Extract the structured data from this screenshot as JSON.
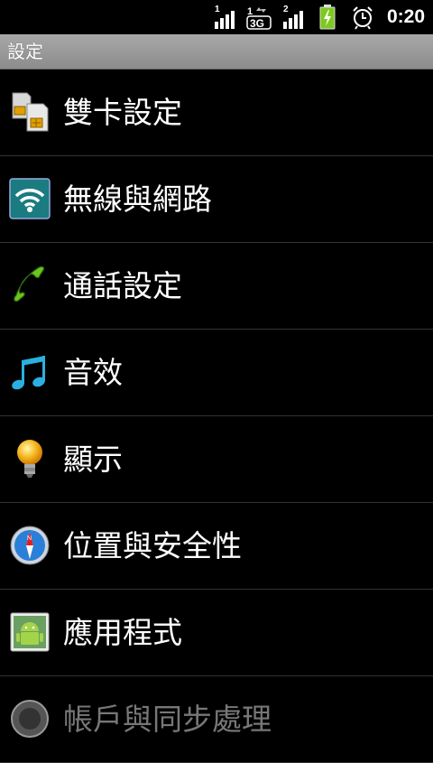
{
  "status_bar": {
    "sim1_label": "1",
    "sim2_label": "2",
    "network_type": "3G",
    "time": "0:20",
    "icons": [
      "signal-sim1-icon",
      "3g-data-icon",
      "signal-sim2-icon",
      "battery-charging-icon",
      "alarm-icon"
    ]
  },
  "title_bar": {
    "title": "設定"
  },
  "settings": {
    "items": [
      {
        "label": "雙卡設定",
        "icon": "dual-sim-icon"
      },
      {
        "label": "無線與網路",
        "icon": "wireless-icon"
      },
      {
        "label": "通話設定",
        "icon": "phone-icon"
      },
      {
        "label": "音效",
        "icon": "music-note-icon"
      },
      {
        "label": "顯示",
        "icon": "light-bulb-icon"
      },
      {
        "label": "位置與安全性",
        "icon": "compass-icon"
      },
      {
        "label": "應用程式",
        "icon": "android-icon"
      },
      {
        "label": "帳戶與同步處理",
        "icon": "sync-icon"
      }
    ]
  },
  "colors": {
    "background": "#000000",
    "title_bar": "#9a9a9a",
    "divider": "#333333"
  }
}
